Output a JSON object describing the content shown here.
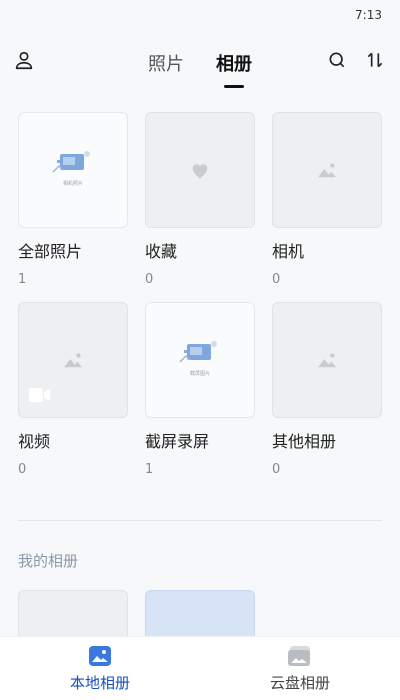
{
  "status": {
    "time": "7:13"
  },
  "header": {
    "tabs": [
      {
        "label": "照片",
        "active": false
      },
      {
        "label": "相册",
        "active": true
      }
    ],
    "icons": [
      "person-icon",
      "search-icon",
      "sort-icon"
    ]
  },
  "albums": [
    {
      "name": "全部照片",
      "count": "1",
      "thumb_caption": "相机照片"
    },
    {
      "name": "收藏",
      "count": "0"
    },
    {
      "name": "相机",
      "count": "0"
    },
    {
      "name": "视频",
      "count": "0"
    },
    {
      "name": "截屏录屏",
      "count": "1",
      "thumb_caption": "截屏图片"
    },
    {
      "name": "其他相册",
      "count": "0"
    }
  ],
  "my_albums": {
    "title": "我的相册"
  },
  "bottom_nav": [
    {
      "label": "本地相册",
      "active": true,
      "icon": "photo-album-icon"
    },
    {
      "label": "云盘相册",
      "active": false,
      "icon": "cloud-album-icon"
    }
  ],
  "colors": {
    "accent": "#1b4fbf",
    "background": "#f7f8fa"
  }
}
